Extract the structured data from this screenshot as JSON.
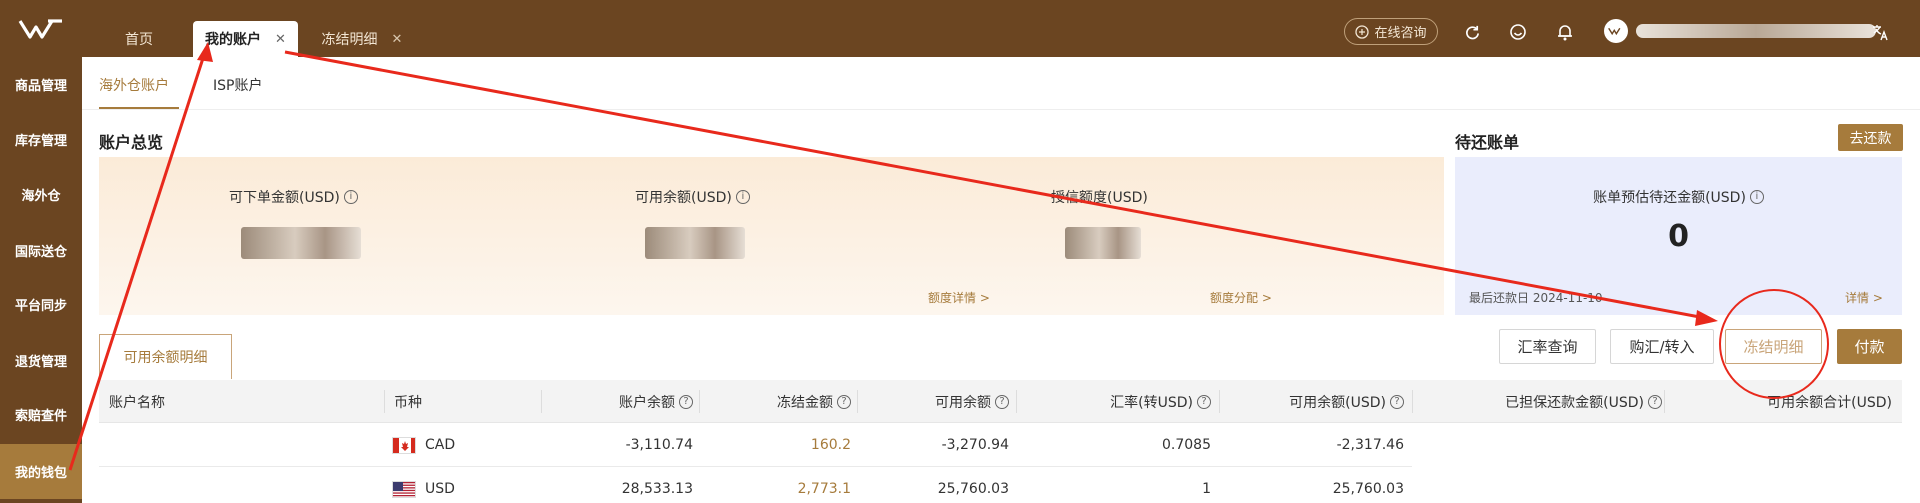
{
  "header": {
    "tabs": [
      {
        "label": "首页"
      },
      {
        "label": "我的账户"
      },
      {
        "label": "冻结明细"
      }
    ],
    "consult_label": "在线咨询"
  },
  "sidebar": {
    "items": [
      {
        "label": "商品管理"
      },
      {
        "label": "库存管理"
      },
      {
        "label": "海外仓"
      },
      {
        "label": "国际送仓"
      },
      {
        "label": "平台同步"
      },
      {
        "label": "退货管理"
      },
      {
        "label": "索赔查件"
      },
      {
        "label": "我的钱包"
      }
    ]
  },
  "subtabs": [
    {
      "label": "海外仓账户"
    },
    {
      "label": "ISP账户"
    }
  ],
  "overview": {
    "title": "账户总览",
    "cards": [
      {
        "label": "可下单金额(USD)"
      },
      {
        "label": "可用余额(USD)"
      },
      {
        "label": "授信额度(USD)"
      }
    ],
    "links": [
      "额度详情 >",
      "额度分配 >"
    ]
  },
  "pending": {
    "title": "待还账单",
    "repay_button": "去还款",
    "label": "账单预估待还金额(USD)",
    "value": "0",
    "due_date": "最后还款日 2024-11-10",
    "detail_link": "详情 >"
  },
  "actions": {
    "rate_query": "汇率查询",
    "exchange": "购汇/转入",
    "frozen_detail": "冻结明细",
    "pay": "付款"
  },
  "detail_tab": "可用余额明细",
  "table": {
    "columns": [
      "账户名称",
      "币种",
      "账户余额",
      "冻结金额",
      "可用余额",
      "汇率(转USD)",
      "可用余额(USD)",
      "已担保还款金额(USD)",
      "可用余额合计(USD)"
    ],
    "rows": [
      {
        "currency": "CAD",
        "balance": "-3,110.74",
        "frozen": "160.2",
        "available": "-3,270.94",
        "rate": "0.7085",
        "available_usd": "-2,317.46"
      },
      {
        "currency": "USD",
        "balance": "28,533.13",
        "frozen": "2,773.1",
        "available": "25,760.03",
        "rate": "1",
        "available_usd": "25,760.03"
      }
    ]
  },
  "colors": {
    "brand_dark": "#6b4521",
    "accent": "#a67b3c",
    "annotation": "#e8291c"
  }
}
